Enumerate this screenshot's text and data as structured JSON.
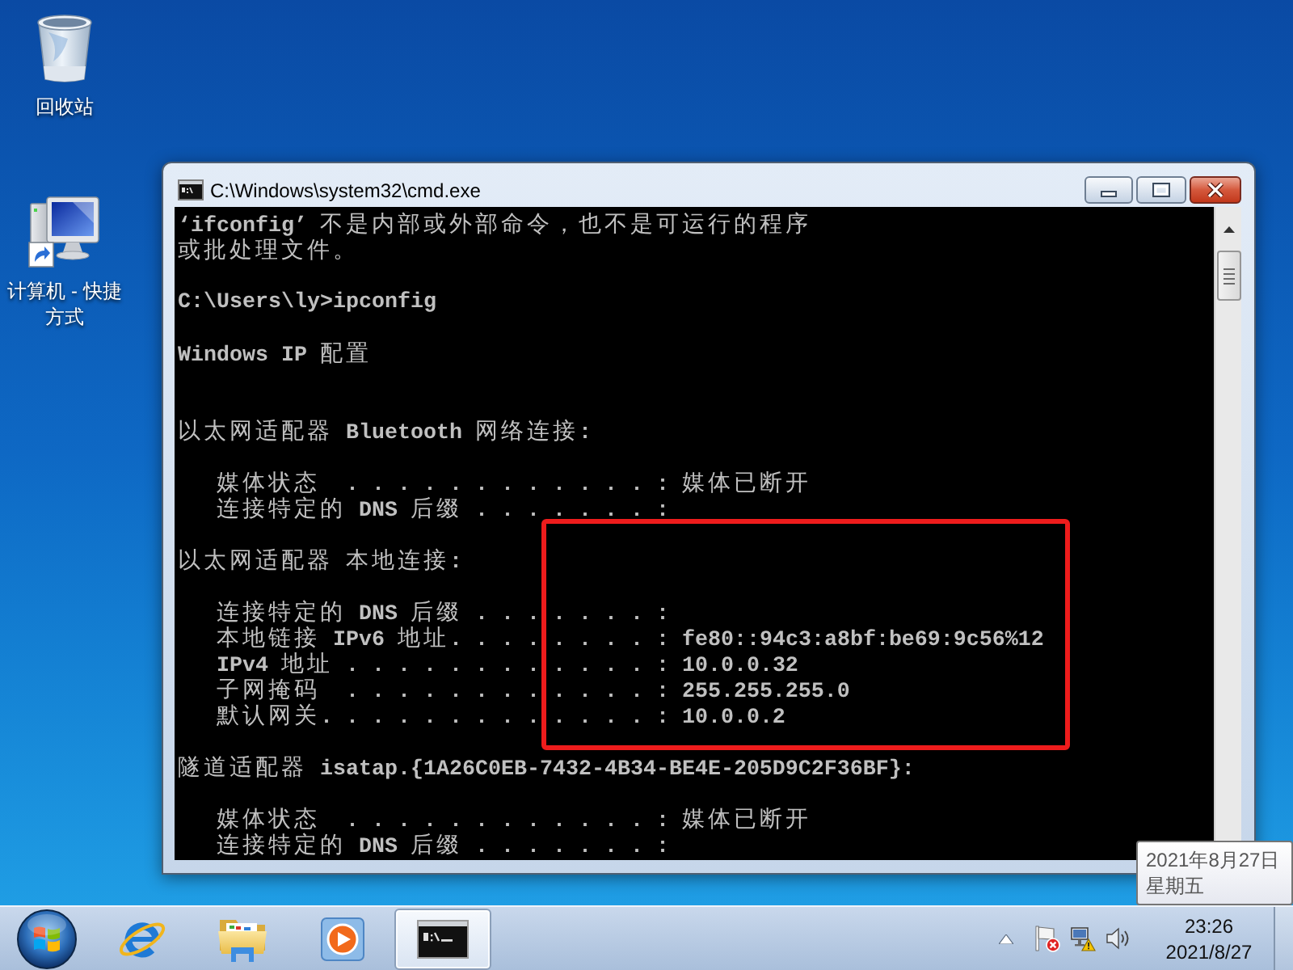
{
  "desktop": {
    "icons": [
      {
        "kind": "recycle_bin",
        "label": "回收站"
      },
      {
        "kind": "computer_shortcut",
        "label": "计算机 - 快捷方式"
      }
    ]
  },
  "window": {
    "title": "C:\\Windows\\system32\\cmd.exe",
    "console": {
      "lines": [
        {
          "kind": "text",
          "text": "‘ifconfig’ 不是内部或外部命令，也不是可运行的程序"
        },
        {
          "kind": "text",
          "text": "或批处理文件。"
        },
        {
          "kind": "blank"
        },
        {
          "kind": "text",
          "text": "C:\\Users\\ly>ipconfig"
        },
        {
          "kind": "blank"
        },
        {
          "kind": "text",
          "text": "Windows IP 配置"
        },
        {
          "kind": "blank"
        },
        {
          "kind": "blank"
        },
        {
          "kind": "text",
          "text": "以太网适配器 Bluetooth 网络连接:"
        },
        {
          "kind": "blank"
        },
        {
          "kind": "text",
          "text": "   媒体状态  . . . . . . . . . . . . : 媒体已断开"
        },
        {
          "kind": "text",
          "text": "   连接特定的 DNS 后缀 . . . . . . . :"
        },
        {
          "kind": "blank"
        },
        {
          "kind": "text",
          "text": "以太网适配器 本地连接:"
        },
        {
          "kind": "blank"
        },
        {
          "kind": "text",
          "text": "   连接特定的 DNS 后缀 . . . . . . . :"
        },
        {
          "kind": "text",
          "text": "   本地链接 IPv6 地址. . . . . . . . : fe80::94c3:a8bf:be69:9c56%12"
        },
        {
          "kind": "text",
          "text": "   IPv4 地址 . . . . . . . . . . . . : 10.0.0.32"
        },
        {
          "kind": "text",
          "text": "   子网掩码  . . . . . . . . . . . . : 255.255.255.0"
        },
        {
          "kind": "text",
          "text": "   默认网关. . . . . . . . . . . . . : 10.0.0.2"
        },
        {
          "kind": "blank"
        },
        {
          "kind": "text",
          "text": "隧道适配器 isatap.{1A26C0EB-7432-4B34-BE4E-205D9C2F36BF}:"
        },
        {
          "kind": "blank"
        },
        {
          "kind": "text",
          "text": "   媒体状态  . . . . . . . . . . . . : 媒体已断开"
        },
        {
          "kind": "text",
          "text": "   连接特定的 DNS 后缀 . . . . . . . :"
        }
      ]
    }
  },
  "annotation": {
    "kind": "rectangle"
  },
  "tooltip": {
    "lines": [
      "2021年8月27日",
      "星期五"
    ]
  },
  "taskbar": {
    "apps": [
      {
        "kind": "browser",
        "selected": false
      },
      {
        "kind": "file_explorer",
        "selected": false
      },
      {
        "kind": "media_player",
        "selected": false
      },
      {
        "kind": "command_prompt",
        "selected": true
      }
    ],
    "tray": [
      {
        "kind": "flag_alert"
      },
      {
        "kind": "network_warning"
      },
      {
        "kind": "volume"
      }
    ],
    "clock": {
      "time": "23:26",
      "date": "2021/8/27"
    }
  }
}
